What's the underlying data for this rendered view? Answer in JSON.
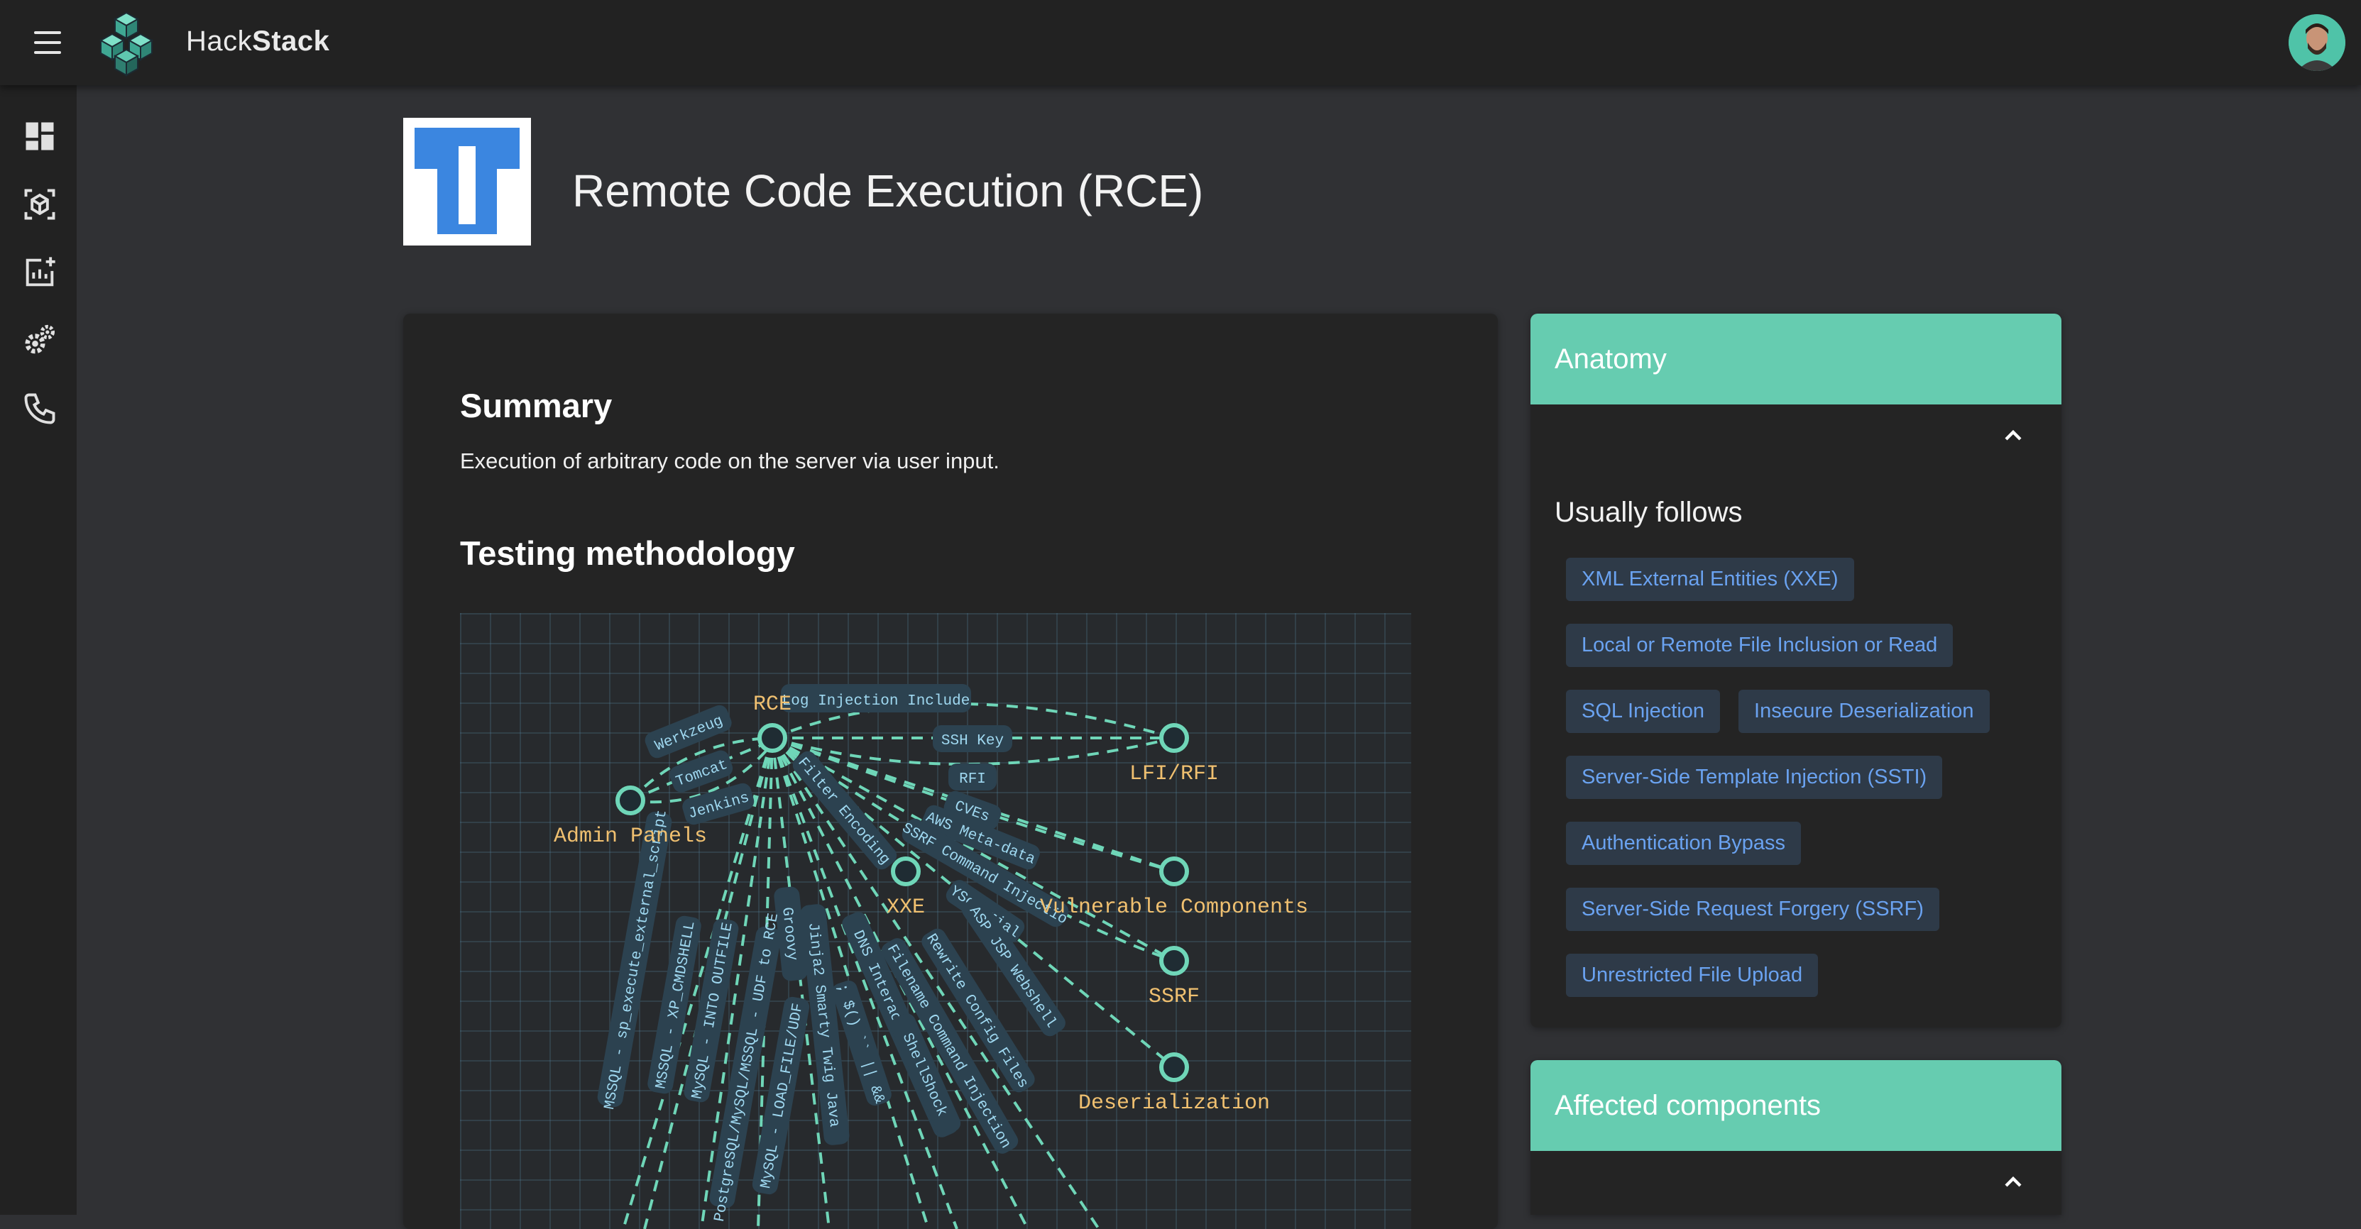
{
  "app": {
    "brand_light": "Hack",
    "brand_bold": "Stack"
  },
  "page": {
    "title": "Remote Code Execution (RCE)"
  },
  "summary": {
    "heading": "Summary",
    "text": "Execution of arbitrary code on the server via user input."
  },
  "methodology": {
    "heading": "Testing methodology",
    "nodes": [
      {
        "id": "rce",
        "label": "RCE"
      },
      {
        "id": "lfi",
        "label": "LFI/RFI"
      },
      {
        "id": "admin",
        "label": "Admin Panels"
      },
      {
        "id": "xxe",
        "label": "XXE"
      },
      {
        "id": "vuln",
        "label": "Vulnerable Components"
      },
      {
        "id": "ssrf",
        "label": "SSRF"
      },
      {
        "id": "deser",
        "label": "Deserialization"
      }
    ],
    "edge_labels": [
      "Log Injection Include",
      "SSH Key",
      "RFI",
      "Werkzeug",
      "Tomcat",
      "Jenkins",
      "CVEs",
      "AWS Meta-data",
      "Filter Encoding",
      "SSRF Command Injectio",
      "YSoSerial",
      "ASP JSP Webshell",
      "Rewrite Config Files",
      "Filename Command Injection",
      "DNS Interaction Payload",
      "ShellShock",
      "Jinja2 Smarty Twig Java",
      "Groovy",
      "MSSQL - sp_execute_external_script",
      "MSSQL - XP_CMDSHELL",
      "MySQL - INTO OUTFILE",
      "PostgreSQL/MySQL/MSSQL - UDF to RCE",
      "MySQL - LOAD_FILE/UDF",
      "; $() `` || &&"
    ]
  },
  "anatomy": {
    "heading": "Anatomy",
    "follows_title": "Usually follows",
    "follows": [
      "XML External Entities (XXE)",
      "Local or Remote File Inclusion or Read",
      "SQL Injection",
      "Insecure Deserialization",
      "Server-Side Template Injection (SSTI)",
      "Authentication Bypass",
      "Server-Side Request Forgery (SSRF)",
      "Unrestricted File Upload"
    ]
  },
  "affected": {
    "heading": "Affected components"
  },
  "colors": {
    "accent": "#66ccb0",
    "node_label": "#f0c070",
    "chip_text": "#6aa2f0"
  },
  "icons": {
    "rail": [
      "dashboard-icon",
      "cube-scan-icon",
      "add-chart-icon",
      "gears-icon",
      "phone-icon"
    ]
  }
}
